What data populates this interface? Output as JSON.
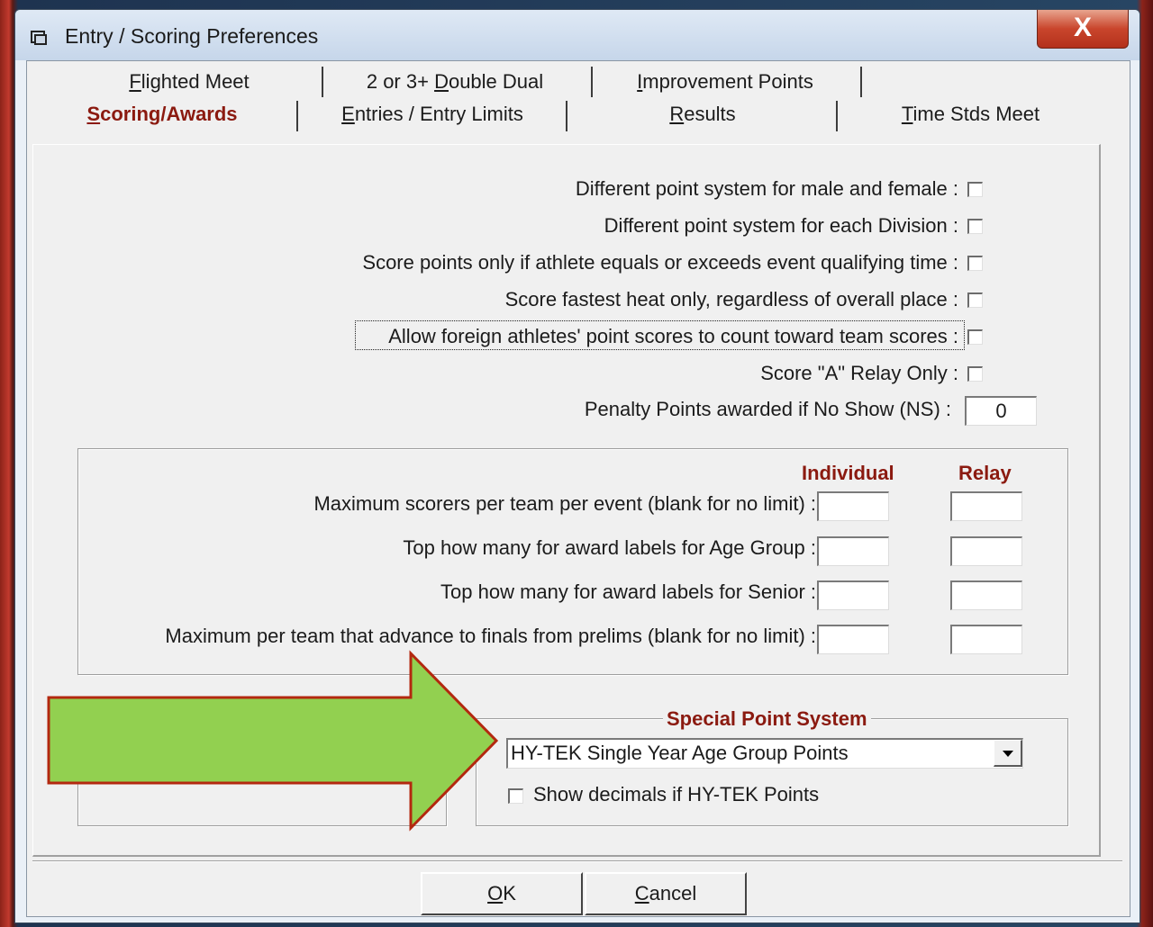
{
  "window": {
    "title": "Entry / Scoring Preferences",
    "close_glyph": "X"
  },
  "tabs_row1": [
    {
      "label": "Flighted Meet",
      "mnemonic": "F",
      "rest": "lighted Meet"
    },
    {
      "label": "2 or 3+ Double Dual",
      "pre": "2 or 3+ ",
      "mnemonic": "D",
      "rest": "ouble Dual"
    },
    {
      "label": "Improvement Points",
      "mnemonic": "I",
      "rest": "mprovement Points"
    }
  ],
  "tabs_row2": [
    {
      "label": "Scoring/Awards",
      "mnemonic": "S",
      "rest": "coring/Awards",
      "active": true
    },
    {
      "label": "Entries / Entry Limits",
      "mnemonic": "E",
      "rest": "ntries / Entry Limits"
    },
    {
      "label": "Results",
      "mnemonic": "R",
      "rest": "esults"
    },
    {
      "label": "Time Stds Meet",
      "mnemonic": "T",
      "rest": "ime Stds Meet"
    }
  ],
  "options": [
    {
      "label": "Different point system for male and female :",
      "checked": false
    },
    {
      "label": "Different point system for each Division :",
      "checked": false
    },
    {
      "label": "Score points only if athlete equals or exceeds event qualifying time :",
      "checked": false
    },
    {
      "label": "Score fastest heat only, regardless of overall place :",
      "checked": false
    },
    {
      "label": "Allow foreign athletes' point scores to count toward team scores :",
      "checked": false
    },
    {
      "label": "Score \"A\" Relay Only :",
      "checked": false
    }
  ],
  "penalty": {
    "label": "Penalty Points awarded if No Show (NS) :",
    "value": "0"
  },
  "limits": {
    "col_individual": "Individual",
    "col_relay": "Relay",
    "rows": [
      {
        "label": "Maximum scorers per team per event (blank for no limit) :",
        "individual": "",
        "relay": ""
      },
      {
        "label": "Top how many for award labels for Age Group :",
        "individual": "",
        "relay": ""
      },
      {
        "label": "Top how many for award labels for Senior :",
        "individual": "",
        "relay": ""
      },
      {
        "label": "Maximum per team that advance to finals from prelims (blank for no limit) :",
        "individual": "",
        "relay": ""
      }
    ]
  },
  "special": {
    "legend": "Special Point System",
    "selected": "HY-TEK Single Year Age Group Points",
    "decimals_label": "Show decimals if HY-TEK Points",
    "decimals_checked": false
  },
  "buttons": {
    "ok": {
      "mnemonic": "O",
      "rest": "K"
    },
    "cancel": {
      "mnemonic": "C",
      "rest": "ancel"
    }
  },
  "colors": {
    "accent_text": "#8b1a10",
    "arrow_fill": "#92d050",
    "arrow_stroke": "#b3280f"
  }
}
